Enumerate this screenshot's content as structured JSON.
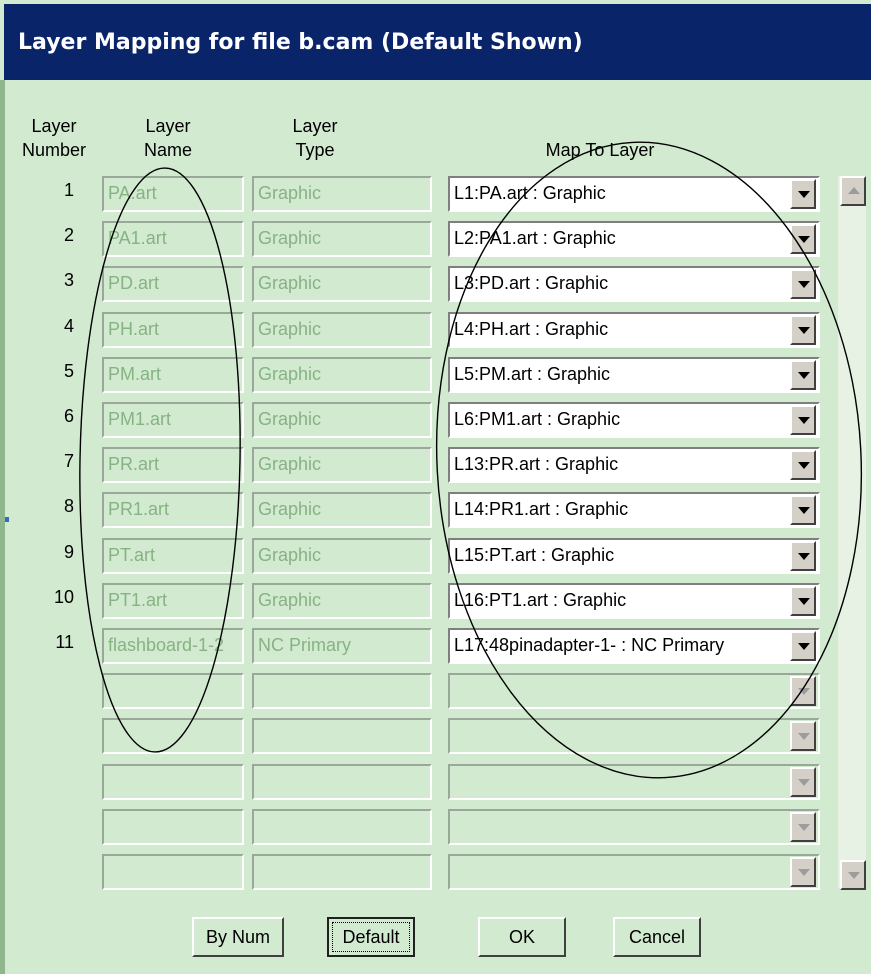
{
  "window": {
    "title": "Layer Mapping for file b.cam (Default Shown)"
  },
  "headers": {
    "number": [
      "Layer",
      "Number"
    ],
    "name": [
      "Layer",
      "Name"
    ],
    "type": [
      "Layer",
      "Type"
    ],
    "map_to": "Map To Layer"
  },
  "rows": [
    {
      "num": "1",
      "name": "PA.art",
      "type": "Graphic",
      "map": "L1:PA.art  : Graphic"
    },
    {
      "num": "2",
      "name": "PA1.art",
      "type": "Graphic",
      "map": "L2:PA1.art  : Graphic"
    },
    {
      "num": "3",
      "name": "PD.art",
      "type": "Graphic",
      "map": "L3:PD.art  : Graphic"
    },
    {
      "num": "4",
      "name": "PH.art",
      "type": "Graphic",
      "map": "L4:PH.art  : Graphic"
    },
    {
      "num": "5",
      "name": "PM.art",
      "type": "Graphic",
      "map": "L5:PM.art  : Graphic"
    },
    {
      "num": "6",
      "name": "PM1.art",
      "type": "Graphic",
      "map": "L6:PM1.art  : Graphic"
    },
    {
      "num": "7",
      "name": "PR.art",
      "type": "Graphic",
      "map": "L13:PR.art  : Graphic"
    },
    {
      "num": "8",
      "name": "PR1.art",
      "type": "Graphic",
      "map": "L14:PR1.art  : Graphic"
    },
    {
      "num": "9",
      "name": "PT.art",
      "type": "Graphic",
      "map": "L15:PT.art  : Graphic"
    },
    {
      "num": "10",
      "name": "PT1.art",
      "type": "Graphic",
      "map": "L16:PT1.art  : Graphic"
    },
    {
      "num": "11",
      "name": "flashboard-1-2",
      "type": "NC Primary",
      "map": "L17:48pinadapter-1-  : NC Primary"
    },
    {
      "num": "",
      "name": "",
      "type": "",
      "map": ""
    },
    {
      "num": "",
      "name": "",
      "type": "",
      "map": ""
    },
    {
      "num": "",
      "name": "",
      "type": "",
      "map": ""
    },
    {
      "num": "",
      "name": "",
      "type": "",
      "map": ""
    },
    {
      "num": "",
      "name": "",
      "type": "",
      "map": ""
    }
  ],
  "buttons": {
    "by_num": "By Num",
    "default": "Default",
    "ok": "OK",
    "cancel": "Cancel"
  },
  "colors": {
    "title_bar": "#0a246a",
    "dialog_bg": "#d2ead0",
    "disabled_text": "#86b383"
  }
}
